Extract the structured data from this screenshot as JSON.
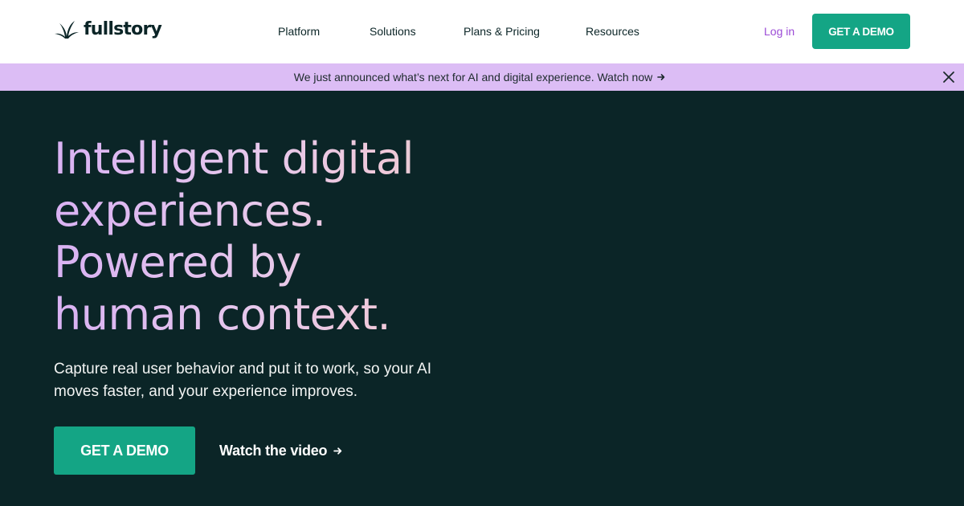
{
  "header": {
    "logo_text": "fullstory",
    "nav": [
      {
        "label": "Platform"
      },
      {
        "label": "Solutions"
      },
      {
        "label": "Plans & Pricing"
      },
      {
        "label": "Resources"
      }
    ],
    "login_label": "Log in",
    "demo_label": "GET A DEMO"
  },
  "banner": {
    "text": "We just announced what’s next for AI and digital experience. Watch now",
    "arrow_icon": "arrow-right-icon",
    "close_icon": "close-icon"
  },
  "hero": {
    "headline": [
      "Intelligent digital",
      "experiences.",
      "Powered by",
      "human context."
    ],
    "subtext_lines": [
      "Capture real user behavior and put it to work, so your AI",
      "moves faster, and your experience improves."
    ],
    "demo_label": "GET A DEMO",
    "watch_label": "Watch the video"
  },
  "colors": {
    "dark_bg": "#0b2527",
    "accent_green": "#14a585",
    "banner_bg": "#dcbdf5",
    "login_purple": "#9b4bd6"
  }
}
